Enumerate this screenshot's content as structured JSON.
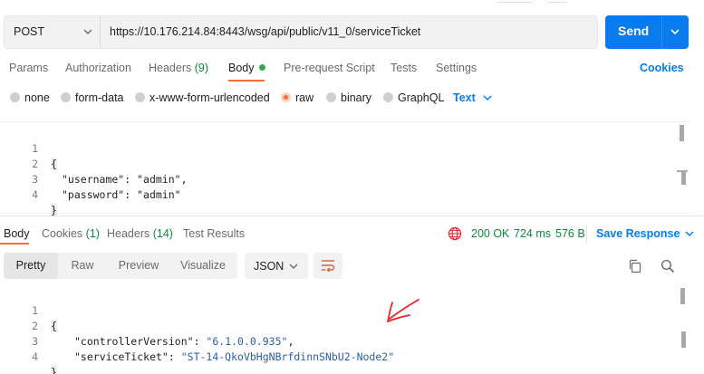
{
  "request": {
    "method": "POST",
    "url": "https://10.176.214.84:8443/wsg/api/public/v11_0/serviceTicket",
    "send_label": "Send"
  },
  "request_tabs": {
    "params": "Params",
    "authorization": "Authorization",
    "headers_label": "Headers",
    "headers_count": "(9)",
    "body": "Body",
    "prerequest": "Pre-request Script",
    "tests": "Tests",
    "settings": "Settings",
    "cookies": "Cookies"
  },
  "body_types": {
    "none": "none",
    "form_data": "form-data",
    "urlencoded": "x-www-form-urlencoded",
    "raw": "raw",
    "binary": "binary",
    "graphql": "GraphQL",
    "text_format": "Text"
  },
  "request_body": {
    "lines": [
      {
        "n": "1",
        "text": "{"
      },
      {
        "n": "2",
        "key": "\"username\"",
        "sep": ": ",
        "value": "\"admin\"",
        "tail": ","
      },
      {
        "n": "3",
        "key": "\"password\"",
        "sep": ": ",
        "value": "\"admin\"",
        "tail": ""
      },
      {
        "n": "4",
        "text": "}"
      }
    ]
  },
  "response_tabs": {
    "body": "Body",
    "cookies_label": "Cookies",
    "cookies_count": "(1)",
    "headers_label": "Headers",
    "headers_count": "(14)",
    "test_results": "Test Results"
  },
  "response_status": {
    "status": "200 OK",
    "time": "724 ms",
    "size": "576 B",
    "save_response": "Save Response"
  },
  "view_modes": {
    "pretty": "Pretty",
    "raw": "Raw",
    "preview": "Preview",
    "visualize": "Visualize",
    "format": "JSON"
  },
  "response_body": {
    "lines": [
      {
        "n": "1",
        "text": "{"
      },
      {
        "n": "2",
        "key": "\"controllerVersion\"",
        "sep": ": ",
        "value": "\"6.1.0.0.935\"",
        "tail": ","
      },
      {
        "n": "3",
        "key": "\"serviceTicket\"",
        "sep": ": ",
        "value": "\"ST-14-QkoVbHgNBrfdinnSNbU2-Node2\"",
        "tail": ""
      },
      {
        "n": "4",
        "text": "}"
      }
    ]
  },
  "colors": {
    "accent": "#097bed",
    "active_tab": "#ff6c37",
    "status_ok": "#0f8a3b",
    "annotation": "#e8262c"
  },
  "icons": [
    "chevron-down-icon",
    "globe-icon",
    "wrap-lines-icon",
    "copy-icon",
    "search-icon"
  ]
}
